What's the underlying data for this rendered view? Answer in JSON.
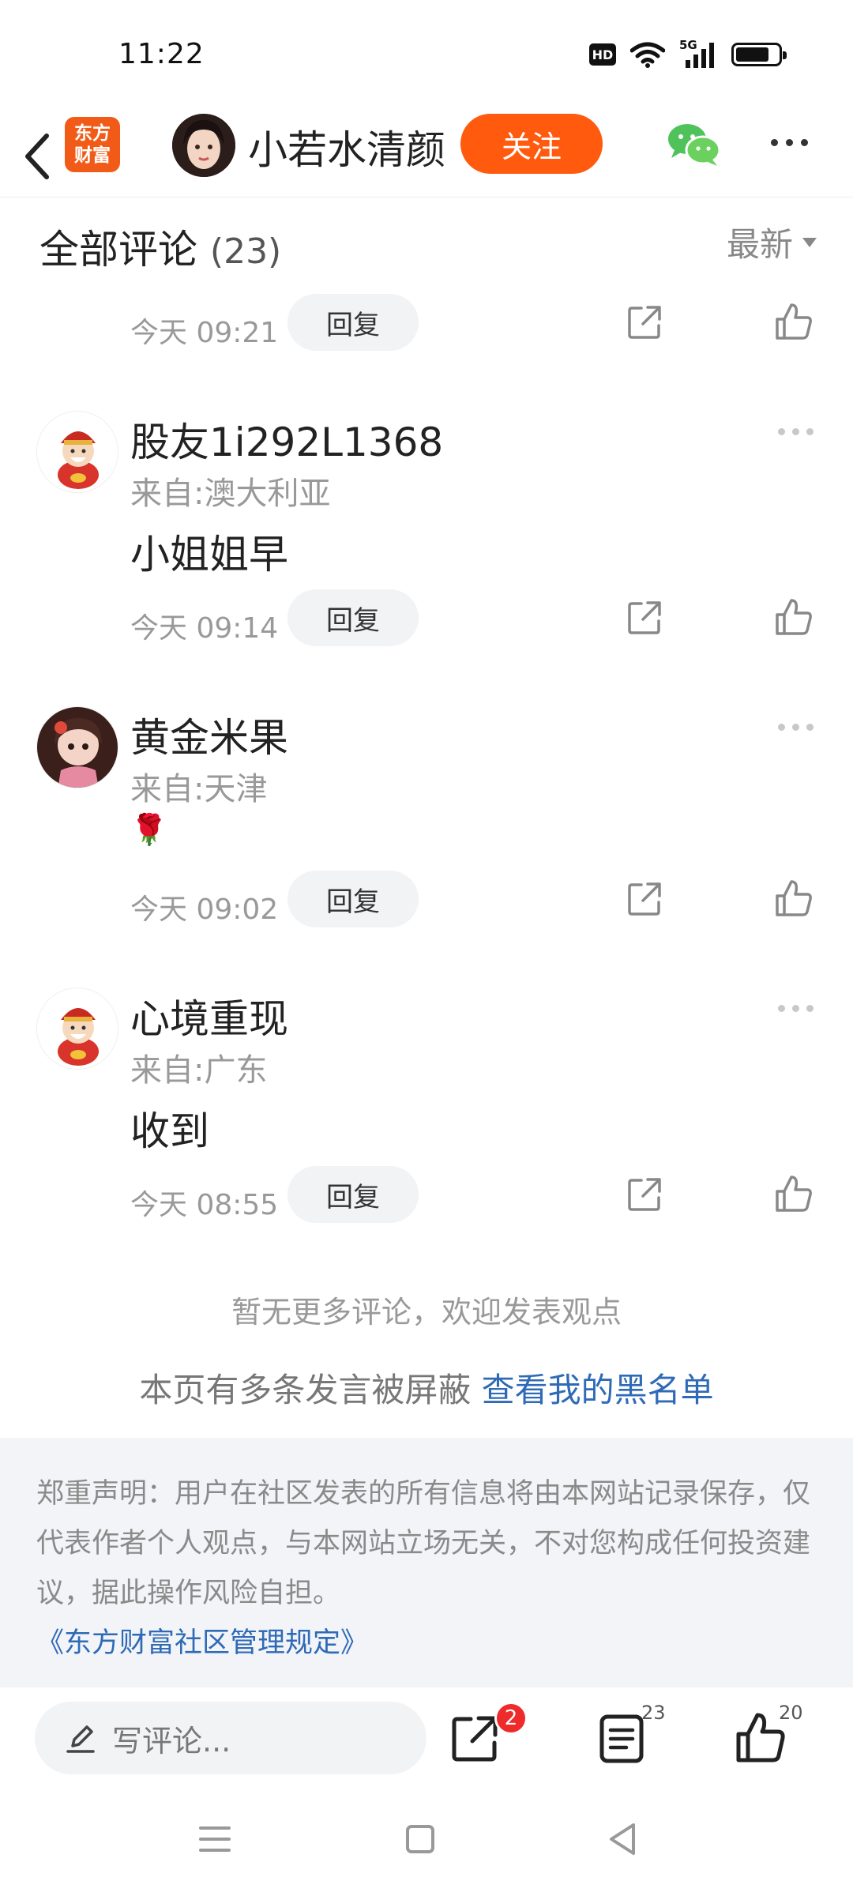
{
  "status_bar": {
    "time": "11:22",
    "network": "5G",
    "hd": "HD"
  },
  "header": {
    "app_logo_line1": "东方",
    "app_logo_line2": "财富",
    "author_name": "小若水清颜",
    "follow_label": "关注"
  },
  "comments_header": {
    "title": "全部评论",
    "count": "(23)",
    "sort_label": "最新"
  },
  "comments": [
    {
      "time": "今天 09:21",
      "reply_label": "回复"
    },
    {
      "user": "股友1i292L1368",
      "location": "来自:澳大利亚",
      "text": "小姐姐早",
      "time": "今天 09:14",
      "reply_label": "回复"
    },
    {
      "user": "黄金米果",
      "location": "来自:天津",
      "text": "🌹",
      "time": "今天 09:02",
      "reply_label": "回复"
    },
    {
      "user": "心境重现",
      "location": "来自:广东",
      "text": "收到",
      "time": "今天 08:55",
      "reply_label": "回复"
    }
  ],
  "footer": {
    "no_more": "暂无更多评论，欢迎发表观点",
    "blocked_text": "本页有多条发言被屏蔽 ",
    "blacklist_link": "查看我的黑名单",
    "disclaimer": "郑重声明：用户在社区发表的所有信息将由本网站记录保存，仅代表作者个人观点，与本网站立场无关，不对您构成任何投资建议，据此操作风险自担。",
    "rules_link": "《东方财富社区管理规定》"
  },
  "bottom_bar": {
    "input_placeholder": "写评论...",
    "share_badge": "2",
    "comment_count": "23",
    "like_count": "20"
  },
  "colors": {
    "accent": "#ff5a0e",
    "link": "#2f6ab7",
    "badge": "#ee2a2a"
  }
}
